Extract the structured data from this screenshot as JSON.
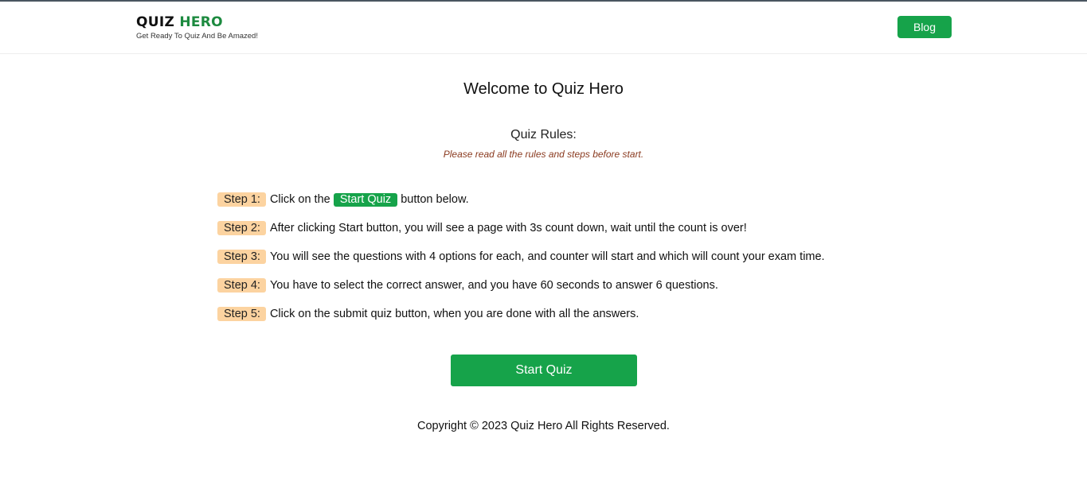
{
  "header": {
    "brand_part1": "QUIZ ",
    "brand_part2": "HERO",
    "tagline": "Get Ready To Quiz And Be Amazed!",
    "blog_label": "Blog"
  },
  "main": {
    "title": "Welcome to Quiz Hero",
    "rules_heading": "Quiz Rules:",
    "rules_note": "Please read all the rules and steps before start.",
    "steps": [
      {
        "badge": "Step 1:",
        "text_before": "Click on the",
        "inline_button": "Start Quiz",
        "text_after": "button below."
      },
      {
        "badge": "Step 2:",
        "text": "After clicking Start button, you will see a page with 3s count down, wait until the count is over!"
      },
      {
        "badge": "Step 3:",
        "text": "You will see the questions with 4 options for each, and counter will start and which will count your exam time."
      },
      {
        "badge": "Step 4:",
        "text": "You have to select the correct answer, and you have 60 seconds to answer 6 questions."
      },
      {
        "badge": "Step 5:",
        "text": "Click on the submit quiz button, when you are done with all the answers."
      }
    ],
    "start_button_label": "Start Quiz"
  },
  "footer": {
    "copyright": "Copyright © 2023 Quiz Hero All Rights Reserved."
  },
  "colors": {
    "accent_green": "#16a34a",
    "brand_green": "#1c8a3f",
    "step_badge_bg": "#fcd3a0",
    "note_text": "#8a3a1f"
  }
}
